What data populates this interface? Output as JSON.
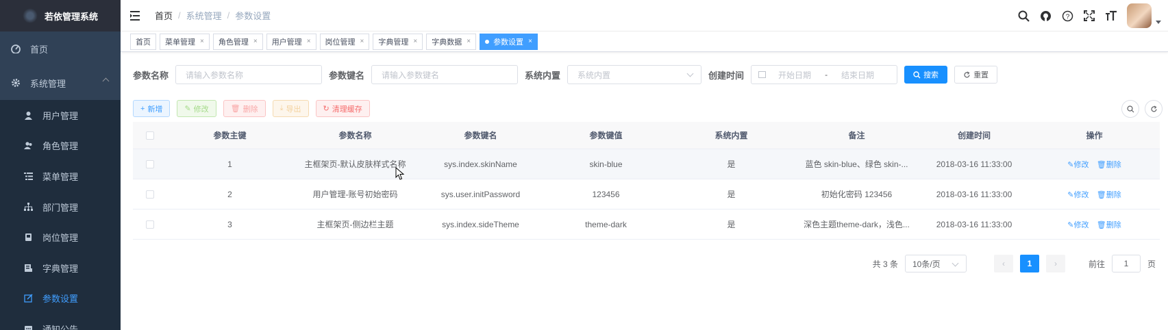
{
  "app": {
    "title": "若依管理系统"
  },
  "sidebar": {
    "items": [
      {
        "label": "首页",
        "icon": "dashboard-icon"
      },
      {
        "label": "系统管理",
        "icon": "gear-icon"
      }
    ],
    "sub_items": [
      {
        "label": "用户管理",
        "icon": "user-icon"
      },
      {
        "label": "角色管理",
        "icon": "peoples-icon"
      },
      {
        "label": "菜单管理",
        "icon": "tree-table-icon"
      },
      {
        "label": "部门管理",
        "icon": "tree-icon"
      },
      {
        "label": "岗位管理",
        "icon": "post-icon"
      },
      {
        "label": "字典管理",
        "icon": "dict-icon"
      },
      {
        "label": "参数设置",
        "icon": "edit-icon",
        "active": true
      },
      {
        "label": "通知公告",
        "icon": "message-icon"
      }
    ]
  },
  "breadcrumb": [
    "首页",
    "系统管理",
    "参数设置"
  ],
  "header_icons": [
    "search-icon",
    "github-icon",
    "question-icon",
    "fullscreen-icon",
    "font-size-icon"
  ],
  "tags": [
    {
      "label": "首页",
      "closable": false
    },
    {
      "label": "菜单管理",
      "closable": true
    },
    {
      "label": "角色管理",
      "closable": true
    },
    {
      "label": "用户管理",
      "closable": true
    },
    {
      "label": "岗位管理",
      "closable": true
    },
    {
      "label": "字典管理",
      "closable": true
    },
    {
      "label": "字典数据",
      "closable": true
    },
    {
      "label": "参数设置",
      "closable": true,
      "active": true
    }
  ],
  "search": {
    "name_label": "参数名称",
    "name_placeholder": "请输入参数名称",
    "key_label": "参数键名",
    "key_placeholder": "请输入参数键名",
    "type_label": "系统内置",
    "type_placeholder": "系统内置",
    "time_label": "创建时间",
    "start_placeholder": "开始日期",
    "range_sep": "-",
    "end_placeholder": "结束日期",
    "search_button": "搜索",
    "reset_button": "重置"
  },
  "toolbar": {
    "add": "新增",
    "edit": "修改",
    "delete": "删除",
    "export": "导出",
    "clear_cache": "清理缓存"
  },
  "table": {
    "columns": [
      "参数主键",
      "参数名称",
      "参数键名",
      "参数键值",
      "系统内置",
      "备注",
      "创建时间",
      "操作"
    ],
    "rows": [
      {
        "id": "1",
        "name": "主框架页-默认皮肤样式名称",
        "key": "sys.index.skinName",
        "value": "skin-blue",
        "builtin": "是",
        "remark": "蓝色 skin-blue、绿色 skin-...",
        "created": "2018-03-16 11:33:00"
      },
      {
        "id": "2",
        "name": "用户管理-账号初始密码",
        "key": "sys.user.initPassword",
        "value": "123456",
        "builtin": "是",
        "remark": "初始化密码 123456",
        "created": "2018-03-16 11:33:00"
      },
      {
        "id": "3",
        "name": "主框架页-侧边栏主题",
        "key": "sys.index.sideTheme",
        "value": "theme-dark",
        "builtin": "是",
        "remark": "深色主题theme-dark，浅色...",
        "created": "2018-03-16 11:33:00"
      }
    ],
    "edit_action": "修改",
    "delete_action": "删除"
  },
  "pagination": {
    "total_text": "共 3 条",
    "page_size": "10条/页",
    "current_page": "1",
    "goto_label": "前往",
    "goto_value": "1",
    "page_unit": "页"
  },
  "colors": {
    "sidebar_bg": "#304156",
    "primary": "#1890ff",
    "active_menu": "#409eff"
  }
}
